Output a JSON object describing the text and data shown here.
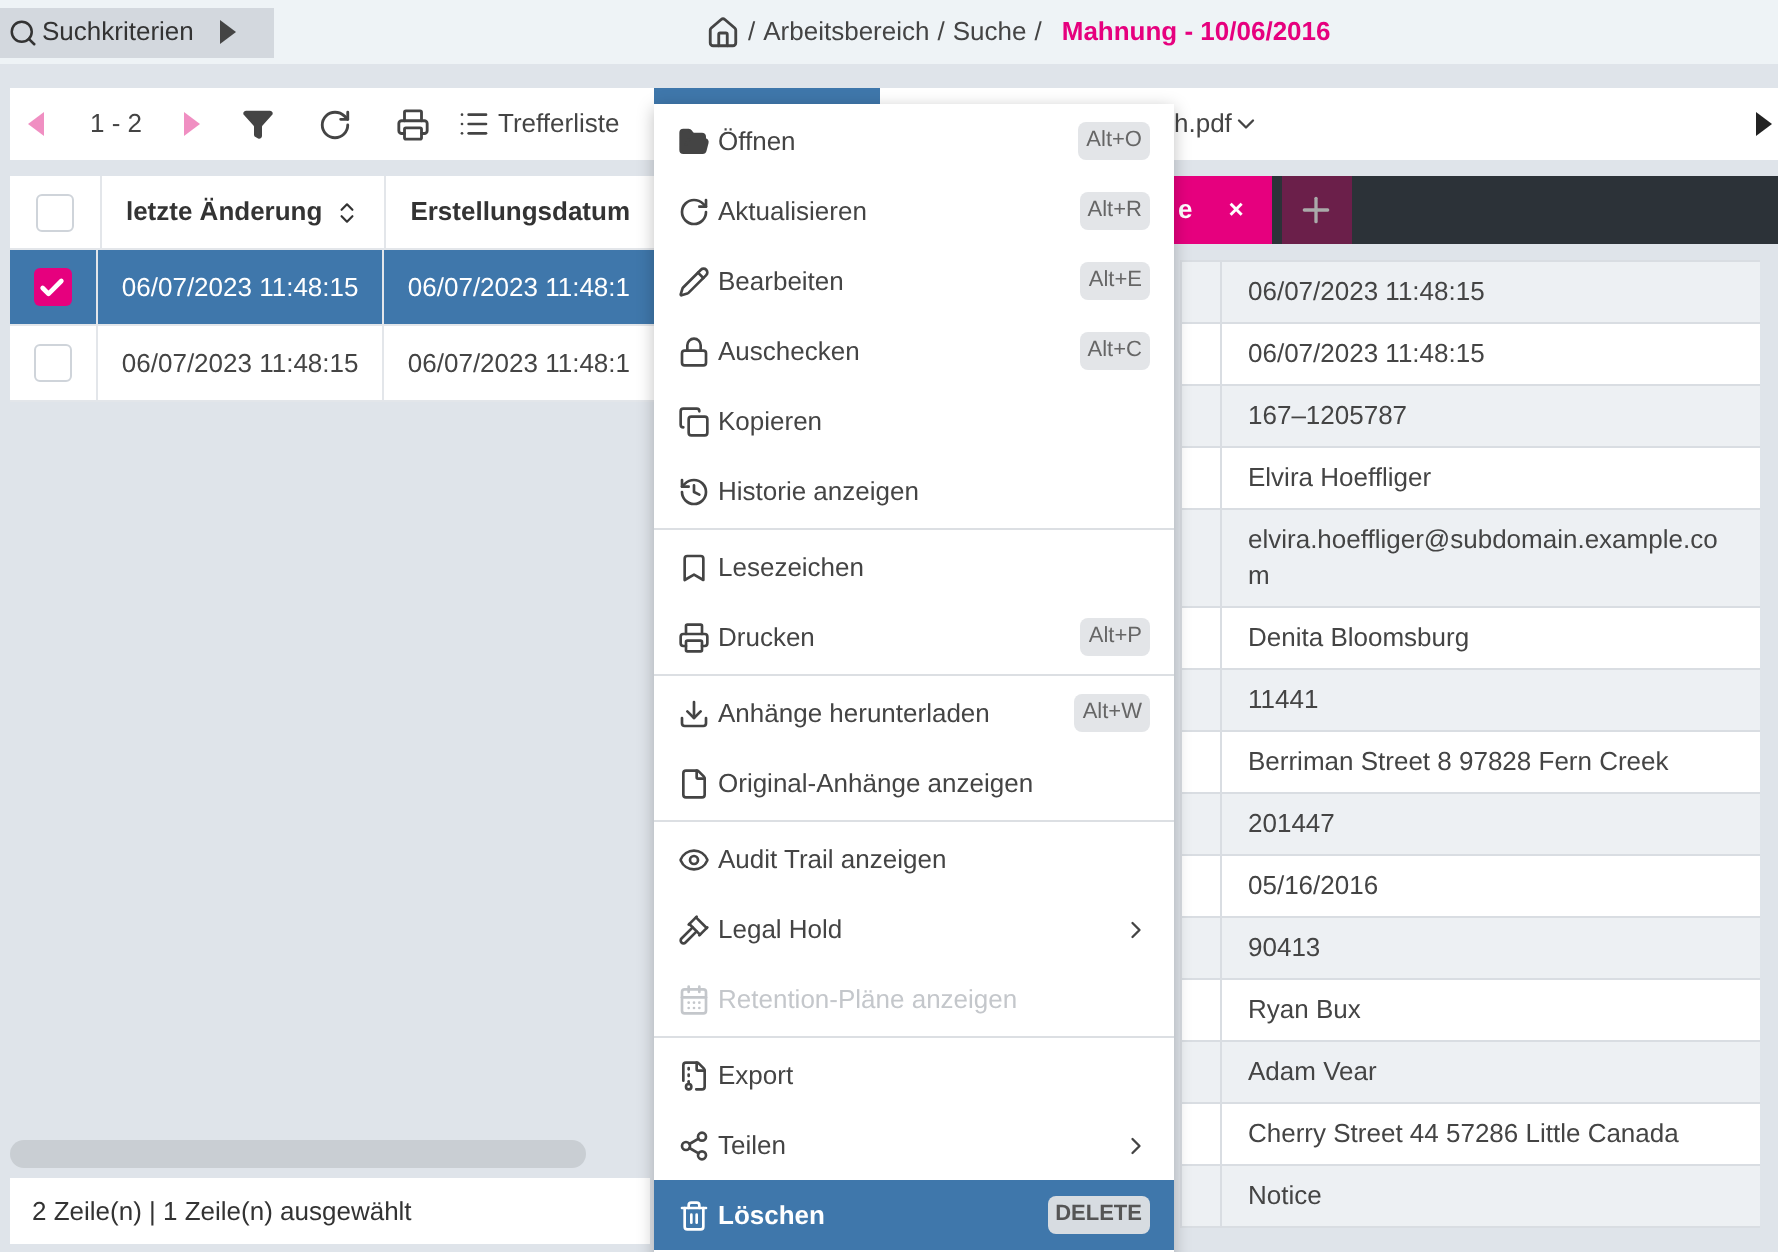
{
  "top_bar": {
    "search_button": "Suchkriterien",
    "breadcrumb": {
      "separator": "/",
      "path": [
        "Arbeitsbereich",
        "Suche"
      ],
      "current": "Mahnung - 10/06/2016"
    }
  },
  "toolbar": {
    "range": "1 - 2",
    "results_button": "Trefferliste",
    "file_name": "h.pdf"
  },
  "table": {
    "header_checked": false,
    "columns": [
      {
        "label": "letzte Änderung",
        "sortable": true
      },
      {
        "label": "Erstellungsdatum",
        "sortable": false
      }
    ],
    "rows": [
      {
        "selected": true,
        "cells": [
          "06/07/2023 11:48:15",
          "06/07/2023 11:48:1"
        ]
      },
      {
        "selected": false,
        "cells": [
          "06/07/2023 11:48:15",
          "06/07/2023 11:48:1"
        ]
      }
    ]
  },
  "status_bar": "2 Zeile(n) | 1 Zeile(n) ausgewählt",
  "detail": {
    "tabs": [
      {
        "label": "e",
        "close": "×",
        "selected": true
      }
    ],
    "values": [
      "06/07/2023 11:48:15",
      "06/07/2023 11:48:15",
      "167–1205787",
      "Elvira Hoeffliger",
      "elvira.hoeffliger@subdomain.example.com",
      "Denita Bloomsburg",
      "11441",
      "Berriman Street 8 97828 Fern Creek",
      "201447",
      "05/16/2016",
      "90413",
      "Ryan Bux",
      "Adam Vear",
      "Cherry Street 44 57286 Little Canada",
      "Notice"
    ]
  },
  "context_menu": {
    "groups": [
      [
        {
          "label": "Öffnen",
          "shortcut": "Alt+O",
          "submenu": false,
          "disabled": false,
          "selected": false
        },
        {
          "label": "Aktualisieren",
          "shortcut": "Alt+R",
          "submenu": false,
          "disabled": false,
          "selected": false
        },
        {
          "label": "Bearbeiten",
          "shortcut": "Alt+E",
          "submenu": false,
          "disabled": false,
          "selected": false
        },
        {
          "label": "Auschecken",
          "shortcut": "Alt+C",
          "submenu": false,
          "disabled": false,
          "selected": false
        },
        {
          "label": "Kopieren",
          "submenu": false,
          "disabled": false,
          "selected": false
        },
        {
          "label": "Historie anzeigen",
          "submenu": false,
          "disabled": false,
          "selected": false
        }
      ],
      [
        {
          "label": "Lesezeichen",
          "submenu": false,
          "disabled": false,
          "selected": false
        },
        {
          "label": "Drucken",
          "shortcut": "Alt+P",
          "submenu": false,
          "disabled": false,
          "selected": false
        }
      ],
      [
        {
          "label": "Anhänge herunterladen",
          "shortcut": "Alt+W",
          "submenu": false,
          "disabled": false,
          "selected": false
        },
        {
          "label": "Original-Anhänge anzeigen",
          "submenu": false,
          "disabled": false,
          "selected": false
        }
      ],
      [
        {
          "label": "Audit Trail anzeigen",
          "submenu": false,
          "disabled": false,
          "selected": false
        },
        {
          "label": "Legal Hold",
          "submenu": true,
          "disabled": false,
          "selected": false
        },
        {
          "label": "Retention-Pläne anzeigen",
          "submenu": false,
          "disabled": true,
          "selected": false
        }
      ],
      [
        {
          "label": "Export",
          "submenu": false,
          "disabled": false,
          "selected": false
        },
        {
          "label": "Teilen",
          "submenu": true,
          "disabled": false,
          "selected": false
        },
        {
          "label": "Löschen",
          "shortcut": "DELETE",
          "submenu": false,
          "disabled": false,
          "selected": true
        }
      ]
    ]
  }
}
